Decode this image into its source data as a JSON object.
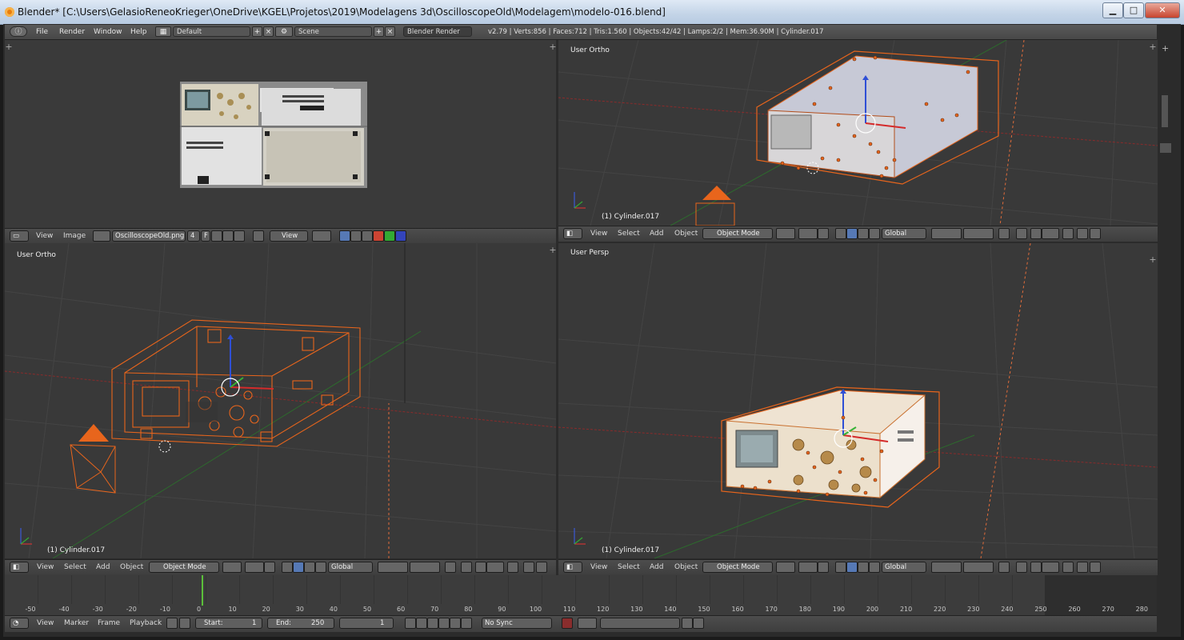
{
  "window": {
    "title": "Blender* [C:\\Users\\GelasioReneoKrieger\\OneDrive\\KGEL\\Projetos\\2019\\Modelagens 3d\\OscilloscopeOld\\Modelagem\\modelo-016.blend]",
    "minimize": "▁",
    "maximize": "□",
    "close": "✕"
  },
  "info": {
    "menus": [
      "File",
      "Render",
      "Window",
      "Help"
    ],
    "layout": "Default",
    "scene": "Scene",
    "engine": "Blender Render",
    "stats": "v2.79 | Verts:856 | Faces:712 | Tris:1.560 | Objects:42/42 | Lamps:2/2 | Mem:36.90M | Cylinder.017"
  },
  "image_editor": {
    "menus": [
      "View",
      "Image"
    ],
    "image_name": "OscilloscopeOld.png",
    "users": "4",
    "fake": "F",
    "view_menu": "View"
  },
  "view_top_right": {
    "label": "User Ortho",
    "object": "(1) Cylinder.017",
    "menus": [
      "View",
      "Select",
      "Add",
      "Object"
    ],
    "mode": "Object Mode",
    "orientation": "Global"
  },
  "view_bottom_left": {
    "label": "User Ortho",
    "object": "(1) Cylinder.017",
    "menus": [
      "View",
      "Select",
      "Add",
      "Object"
    ],
    "mode": "Object Mode",
    "orientation": "Global"
  },
  "view_bottom_right": {
    "label": "User Persp",
    "object": "(1) Cylinder.017",
    "menus": [
      "View",
      "Select",
      "Add",
      "Object"
    ],
    "mode": "Object Mode",
    "orientation": "Global"
  },
  "timeline": {
    "ticks": [
      "-50",
      "-40",
      "-30",
      "-20",
      "-10",
      "0",
      "10",
      "20",
      "30",
      "40",
      "50",
      "60",
      "70",
      "80",
      "90",
      "100",
      "110",
      "120",
      "130",
      "140",
      "150",
      "160",
      "170",
      "180",
      "190",
      "200",
      "210",
      "220",
      "230",
      "240",
      "250",
      "260",
      "270",
      "280"
    ],
    "menus": [
      "View",
      "Marker",
      "Frame",
      "Playback"
    ],
    "start_label": "Start:",
    "start": "1",
    "end_label": "End:",
    "end": "250",
    "current": "1",
    "sync": "No Sync"
  },
  "colors": {
    "selection": "#e8651c",
    "viewport_bg": "#393939",
    "header_bg": "#474747"
  }
}
